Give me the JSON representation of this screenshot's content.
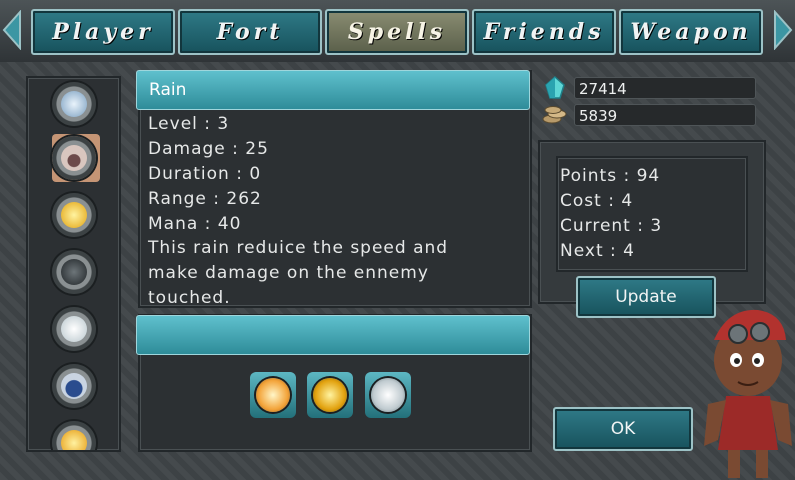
{
  "tabs": [
    {
      "label": "Player",
      "active": false
    },
    {
      "label": "Fort",
      "active": false
    },
    {
      "label": "Spells",
      "active": true
    },
    {
      "label": "Friends",
      "active": false
    },
    {
      "label": "Weapon",
      "active": false
    }
  ],
  "spell_list": [
    "frost-orb",
    "rain-drop",
    "lightning",
    "rock",
    "ice",
    "water",
    "fire"
  ],
  "spell": {
    "name": "Rain",
    "level_label": "Level : 3",
    "damage_label": "Damage : 25",
    "duration_label": "Duration : 0",
    "range_label": "Range : 262",
    "mana_label": "Mana : 40",
    "description": "This rain reduice the speed and make damage on the ennemy touched."
  },
  "slots": [
    "fire-orb",
    "lightning-orb",
    "ice-orb"
  ],
  "resources": {
    "crystals": "27414",
    "coins": "5839"
  },
  "stats": {
    "points": "Points : 94",
    "cost": "Cost : 4",
    "current": "Current : 3",
    "next": "Next : 4"
  },
  "buttons": {
    "update": "Update",
    "ok": "OK"
  },
  "colors": {
    "accent": "#2f8c99",
    "active_tab": "#8a8d72"
  }
}
